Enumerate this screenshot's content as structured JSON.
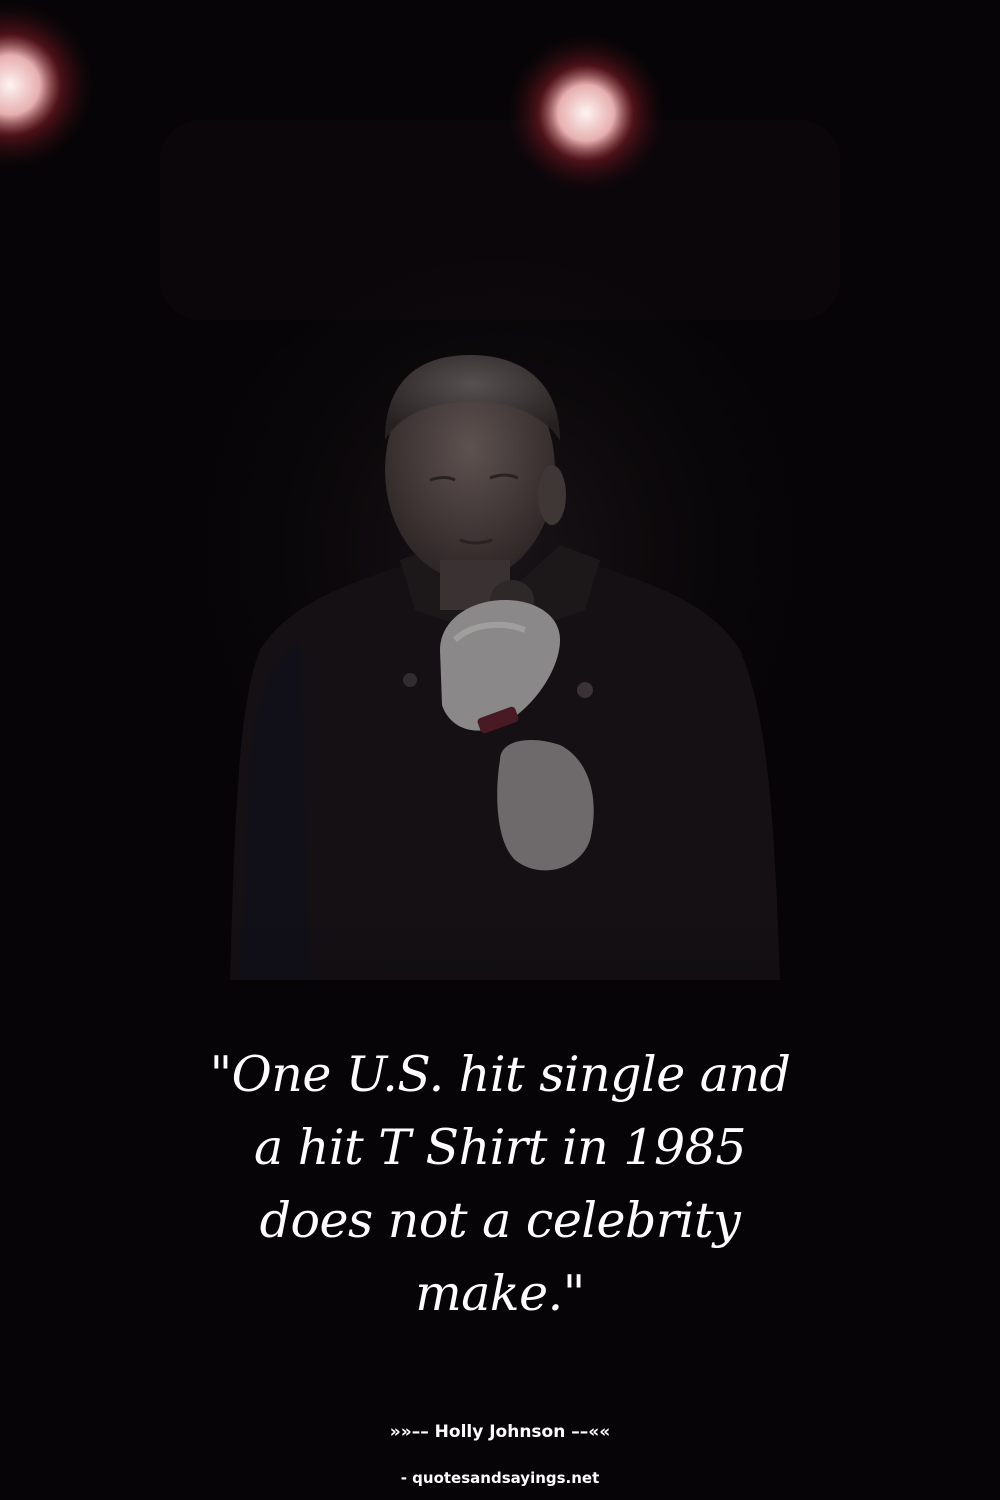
{
  "quote": {
    "text": "\"One U.S. hit single and a hit T Shirt in 1985 does not a celebrity make.\"",
    "line1": "\"One U.S. hit single and",
    "line2": "a hit T Shirt in 1985",
    "line3": "does not a celebrity",
    "line4": "make.\""
  },
  "attribution": {
    "text": "»»–– Holly Johnson ––««"
  },
  "source": {
    "text": "- quotesandsayings.net"
  },
  "photo": {
    "subject": "singer-on-dark-stage",
    "background_color": "#060406",
    "stage_light_color": "#ffe8e8"
  }
}
